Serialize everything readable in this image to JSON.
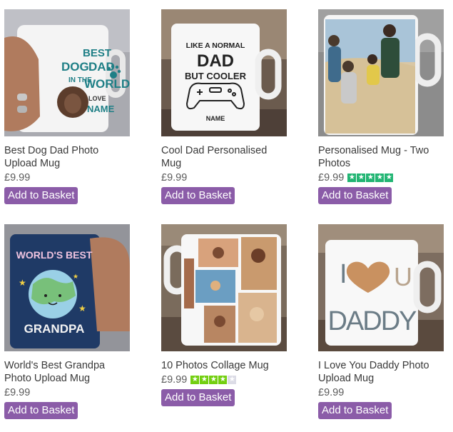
{
  "products": [
    {
      "title": "Best Dog Dad Photo Upload Mug",
      "price": "£9.99",
      "button": "Add to Basket",
      "mug_text": [
        "BEST",
        "DOG",
        "DAD",
        "IN THE",
        "WORLD",
        "LOVE",
        "NAME"
      ],
      "rating": null
    },
    {
      "title": "Cool Dad Personalised Mug",
      "price": "£9.99",
      "button": "Add to Basket",
      "mug_text": [
        "LIKE A NORMAL",
        "DAD",
        "BUT COOLER",
        "NAME"
      ],
      "rating": null
    },
    {
      "title": "Personalised Mug - Two Photos",
      "price": "£9.99",
      "button": "Add to Basket",
      "mug_text": [],
      "rating": 5
    },
    {
      "title": "World's Best Grandpa Photo Upload Mug",
      "price": "£9.99",
      "button": "Add to Basket",
      "mug_text": [
        "WORLD'S BEST",
        "GRANDPA"
      ],
      "rating": null
    },
    {
      "title": "10 Photos Collage Mug",
      "price": "£9.99",
      "button": "Add to Basket",
      "mug_text": [],
      "rating": 4
    },
    {
      "title": "I Love You Daddy Photo Upload Mug",
      "price": "£9.99",
      "button": "Add to Basket",
      "mug_text": [
        "I",
        "U",
        "DADDY"
      ],
      "rating": null
    }
  ],
  "colors": {
    "button": "#8b5ca8",
    "star": "#21b573",
    "star_alt": "#73cf11",
    "teal_text": "#1f7f86",
    "navy_mug": "#1f3a66"
  },
  "icons": [
    "paw-icon",
    "gamepad-icon",
    "heart-icon",
    "globe-icon",
    "star-icon"
  ]
}
